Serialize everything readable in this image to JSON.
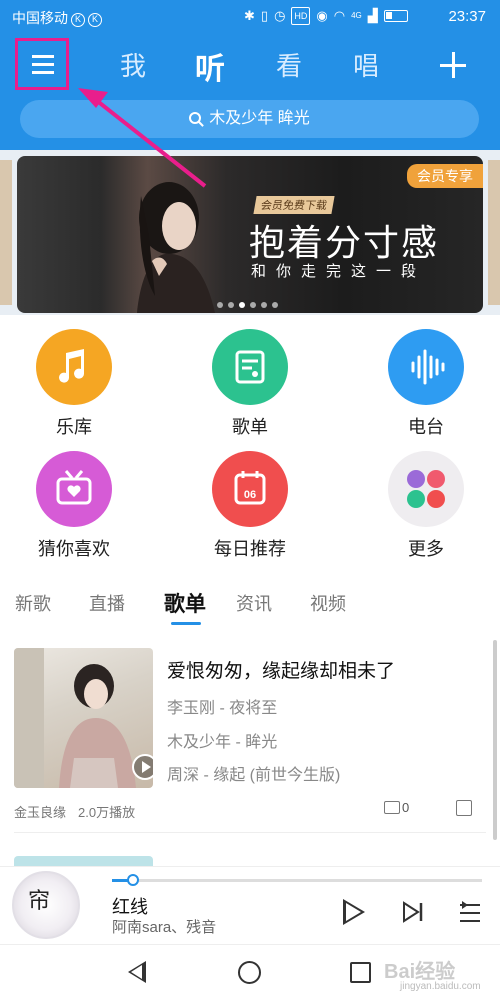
{
  "status_bar": {
    "carrier": "中国移动",
    "carrier_badge": "K",
    "time": "23:37",
    "icons": [
      "bluetooth-icon",
      "vibrate-icon",
      "alarm-icon",
      "hd-icon",
      "eye-icon",
      "wifi-icon",
      "signal-icon",
      "battery-icon"
    ],
    "hd_label": "HD",
    "net_label": "4G"
  },
  "header": {
    "tabs": [
      {
        "label": "我",
        "active": false
      },
      {
        "label": "听",
        "active": true
      },
      {
        "label": "看",
        "active": false
      },
      {
        "label": "唱",
        "active": false
      }
    ],
    "search_text": "木及少年 眸光"
  },
  "banner": {
    "vip_badge": "会员专享",
    "free_tag": "会员免费下载",
    "headline": "抱着分寸感",
    "subline": "和你走完这一段",
    "dot_count": 6,
    "active_dot": 2
  },
  "features": [
    {
      "label": "乐库",
      "icon": "music-note-icon",
      "color": "#f5a623"
    },
    {
      "label": "歌单",
      "icon": "playlist-icon",
      "color": "#2cc28f"
    },
    {
      "label": "电台",
      "icon": "soundwave-icon",
      "color": "#2e9cf2"
    },
    {
      "label": "猜你喜欢",
      "icon": "radio-heart-icon",
      "color": "#d65bd6"
    },
    {
      "label": "每日推荐",
      "icon": "calendar-icon",
      "color": "#f04e4e"
    },
    {
      "label": "更多",
      "icon": "more-apps-icon",
      "color": "#efedf0"
    }
  ],
  "calendar_day": "06",
  "section_tabs": [
    {
      "label": "新歌",
      "active": false
    },
    {
      "label": "直播",
      "active": false
    },
    {
      "label": "歌单",
      "active": true
    },
    {
      "label": "资讯",
      "active": false
    },
    {
      "label": "视频",
      "active": false
    }
  ],
  "playlist_card": {
    "title": "爱恨匆匆，缘起缘却相未了",
    "songs": [
      "李玉刚 - 夜将至",
      "木及少年 - 眸光",
      "周深 - 缘起 (前世今生版)"
    ],
    "source": "金玉良缘",
    "plays": "2.0万播放",
    "comments": "0"
  },
  "player": {
    "song": "红线",
    "artist": "阿南sara、残音",
    "progress": 0.06,
    "disc_text": "帘"
  },
  "watermark": {
    "main": "Bai经验",
    "sub": "jingyan.baidu.com"
  },
  "colors": {
    "brand_blue": "#2490e6",
    "highlight_pink": "#e91e8c"
  }
}
